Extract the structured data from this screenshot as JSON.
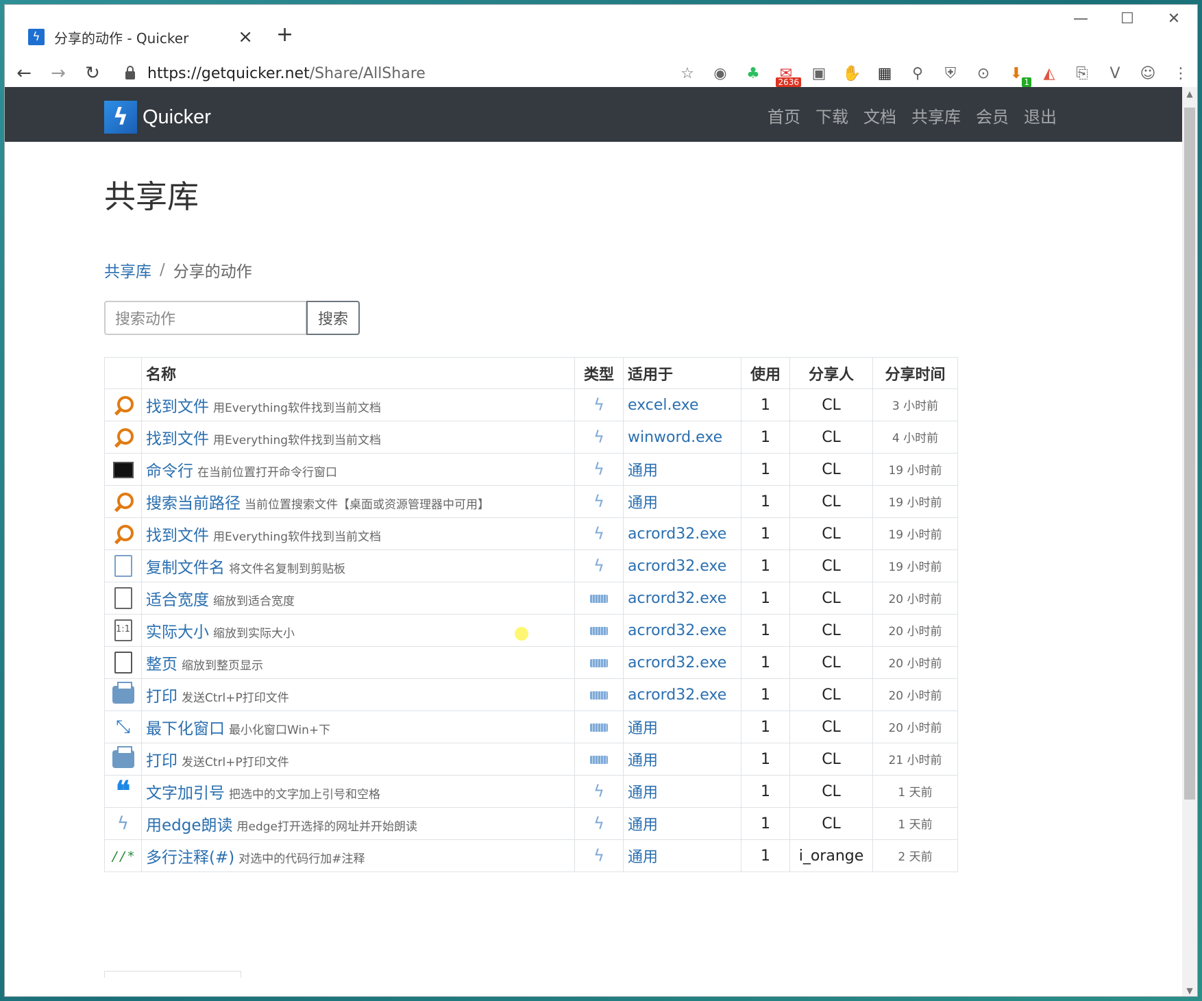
{
  "browser": {
    "tab_title": "分享的动作 - Quicker",
    "tab_close": "×",
    "new_tab": "+",
    "url_host": "https://getquicker.net",
    "url_path": "/Share/AllShare",
    "window_controls": {
      "minimize": "—",
      "maximize": "☐",
      "close": "✕"
    },
    "ext_badge_mail": "2636",
    "ext_badge_dl": "1"
  },
  "navbar": {
    "brand": "Quicker",
    "links": [
      "首页",
      "下载",
      "文档",
      "共享库",
      "会员",
      "退出"
    ]
  },
  "page": {
    "title": "共享库",
    "breadcrumb": {
      "root": "共享库",
      "sep": "/",
      "current": "分享的动作"
    },
    "search": {
      "placeholder": "搜索动作",
      "button": "搜索"
    }
  },
  "table": {
    "headers": {
      "name": "名称",
      "type": "类型",
      "app": "适用于",
      "uses": "使用",
      "sharer": "分享人",
      "time": "分享时间"
    },
    "rows": [
      {
        "icon": "search-icon",
        "name": "找到文件",
        "desc": "用Everything软件找到当前文档",
        "type": "bolt",
        "app": "excel.exe",
        "uses": "1",
        "sharer": "CL",
        "time": "3 小时前"
      },
      {
        "icon": "search-icon",
        "name": "找到文件",
        "desc": "用Everything软件找到当前文档",
        "type": "bolt",
        "app": "winword.exe",
        "uses": "1",
        "sharer": "CL",
        "time": "4 小时前"
      },
      {
        "icon": "terminal-icon",
        "name": "命令行",
        "desc": "在当前位置打开命令行窗口",
        "type": "bolt",
        "app": "通用",
        "uses": "1",
        "sharer": "CL",
        "time": "19 小时前"
      },
      {
        "icon": "search-icon",
        "name": "搜索当前路径",
        "desc": "当前位置搜索文件【桌面或资源管理器中可用】",
        "type": "bolt",
        "app": "通用",
        "uses": "1",
        "sharer": "CL",
        "time": "19 小时前"
      },
      {
        "icon": "search-icon",
        "name": "找到文件",
        "desc": "用Everything软件找到当前文档",
        "type": "bolt",
        "app": "acrord32.exe",
        "uses": "1",
        "sharer": "CL",
        "time": "19 小时前"
      },
      {
        "icon": "copy-file-icon",
        "name": "复制文件名",
        "desc": "将文件名复制到剪贴板",
        "type": "bolt",
        "app": "acrord32.exe",
        "uses": "1",
        "sharer": "CL",
        "time": "19 小时前"
      },
      {
        "icon": "fit-width-icon",
        "name": "适合宽度",
        "desc": "缩放到适合宽度",
        "type": "keyboard",
        "app": "acrord32.exe",
        "uses": "1",
        "sharer": "CL",
        "time": "20 小时前"
      },
      {
        "icon": "actual-size-icon",
        "name": "实际大小",
        "desc": "缩放到实际大小",
        "type": "keyboard",
        "app": "acrord32.exe",
        "uses": "1",
        "sharer": "CL",
        "time": "20 小时前"
      },
      {
        "icon": "page-icon",
        "name": "整页",
        "desc": "缩放到整页显示",
        "type": "keyboard",
        "app": "acrord32.exe",
        "uses": "1",
        "sharer": "CL",
        "time": "20 小时前"
      },
      {
        "icon": "printer-icon",
        "name": "打印",
        "desc": "发送Ctrl+P打印文件",
        "type": "keyboard",
        "app": "acrord32.exe",
        "uses": "1",
        "sharer": "CL",
        "time": "20 小时前"
      },
      {
        "icon": "minimize-icon",
        "name": "最下化窗口",
        "desc": "最小化窗口Win+下",
        "type": "keyboard",
        "app": "通用",
        "uses": "1",
        "sharer": "CL",
        "time": "20 小时前"
      },
      {
        "icon": "printer-icon",
        "name": "打印",
        "desc": "发送Ctrl+P打印文件",
        "type": "keyboard",
        "app": "通用",
        "uses": "1",
        "sharer": "CL",
        "time": "21 小时前"
      },
      {
        "icon": "quote-icon",
        "name": "文字加引号",
        "desc": "把选中的文字加上引号和空格",
        "type": "bolt",
        "app": "通用",
        "uses": "1",
        "sharer": "CL",
        "time": "1 天前"
      },
      {
        "icon": "bolt-icon",
        "name": "用edge朗读",
        "desc": "用edge打开选择的网址并开始朗读",
        "type": "bolt",
        "app": "通用",
        "uses": "1",
        "sharer": "CL",
        "time": "1 天前"
      },
      {
        "icon": "comment-icon",
        "name": "多行注释(#)",
        "desc": "对选中的代码行加#注释",
        "type": "bolt",
        "app": "通用",
        "uses": "1",
        "sharer": "i_orange",
        "time": "2 天前"
      }
    ]
  },
  "icon_text": {
    "actual-size": "1:1",
    "comment": "//*",
    "quote": "❝",
    "minimize": "⤡",
    "bolt": "ϟ"
  }
}
